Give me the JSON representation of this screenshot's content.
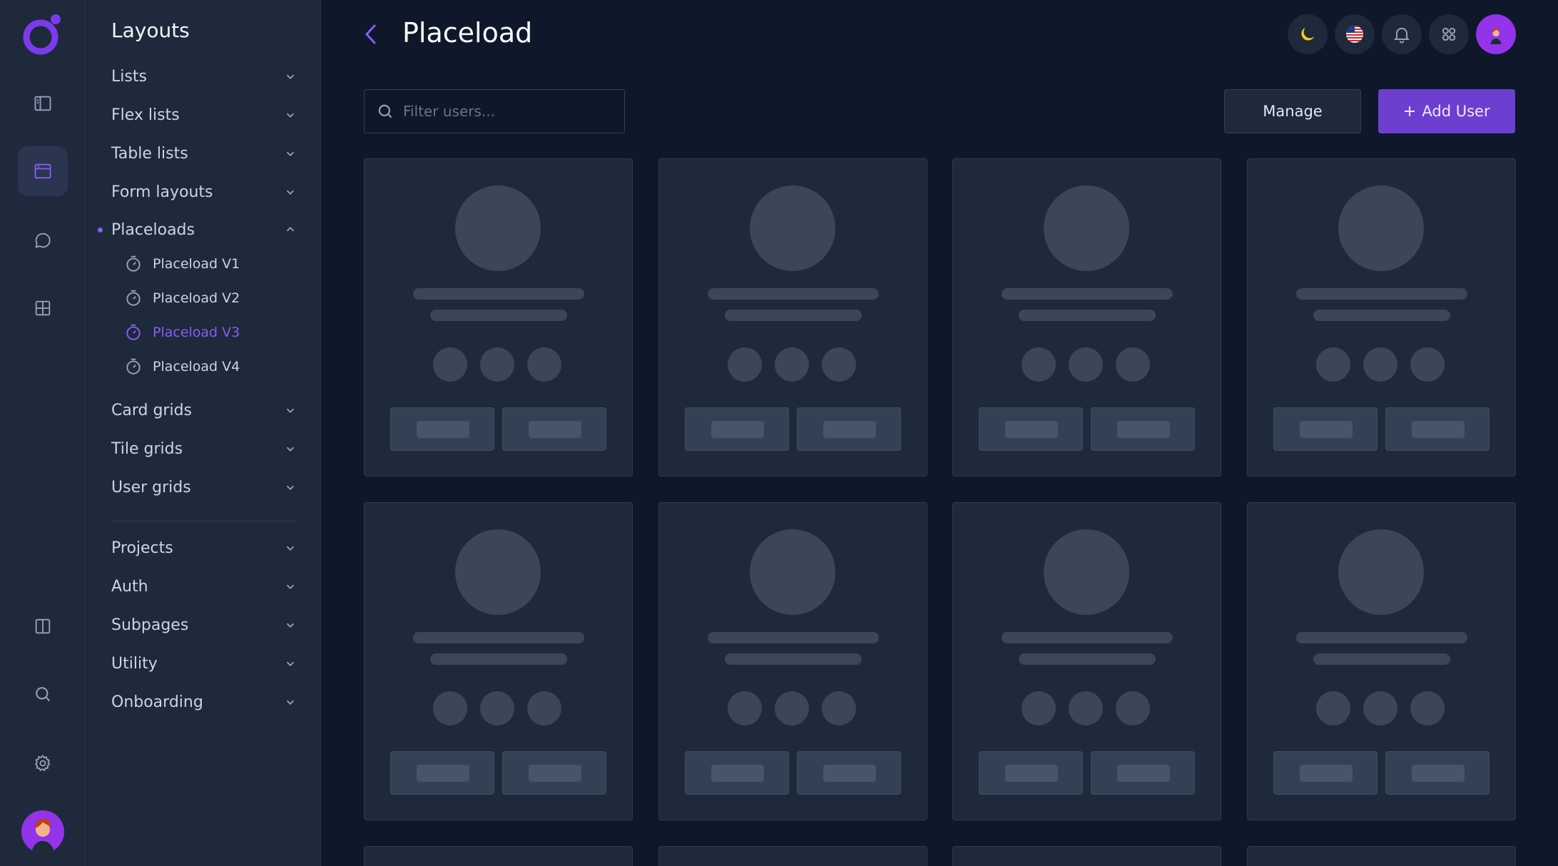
{
  "app": {
    "page_title": "Placeload"
  },
  "rail": {
    "items": [
      "sidebar-icon",
      "layout-icon",
      "chat-icon",
      "grid-icon",
      "columns-icon",
      "search-icon",
      "gear-icon"
    ],
    "active": "layout-icon",
    "accent": "#7c3aed"
  },
  "menu": {
    "title": "Layouts",
    "items": [
      {
        "label": "Lists"
      },
      {
        "label": "Flex lists"
      },
      {
        "label": "Table lists"
      },
      {
        "label": "Form layouts"
      },
      {
        "label": "Placeloads"
      },
      {
        "label": "Card grids"
      },
      {
        "label": "Tile grids"
      },
      {
        "label": "User grids"
      }
    ],
    "subitems": [
      {
        "label": "Placeload V1"
      },
      {
        "label": "Placeload V2"
      },
      {
        "label": "Placeload V3"
      },
      {
        "label": "Placeload V4"
      }
    ],
    "active_subitem": "Placeload V3",
    "bottom_items": [
      {
        "label": "Projects"
      },
      {
        "label": "Auth"
      },
      {
        "label": "Subpages"
      },
      {
        "label": "Utility"
      },
      {
        "label": "Onboarding"
      }
    ]
  },
  "header": {
    "icons": [
      "moon-icon",
      "us-flag-icon",
      "bell-icon",
      "apps-icon",
      "user-avatar"
    ],
    "moon_color": "#facc15"
  },
  "toolbar": {
    "search_placeholder": "Filter users...",
    "manage_label": "Manage",
    "add_label": "Add User",
    "add_color": "#6d3fd1"
  },
  "grid": {
    "columns": 4,
    "full_rows": 2,
    "partial_row_visible": true
  }
}
